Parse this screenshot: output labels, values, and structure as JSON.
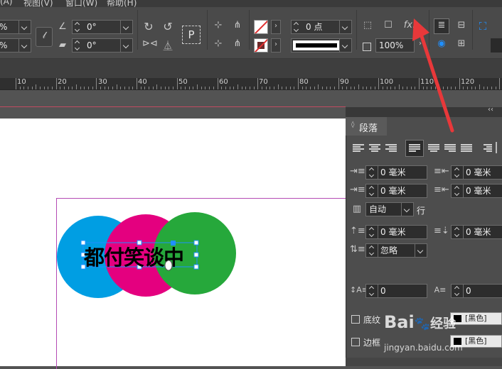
{
  "menu": {
    "items": [
      "(A)",
      "视图(V)",
      "窗口(W)",
      "帮助(H)"
    ]
  },
  "control_panel": {
    "scale_x": "%",
    "scale_y": "%",
    "rotate_angle": "0°",
    "shear_angle": "0°",
    "stroke_weight": "0 点",
    "opacity": "100%",
    "fx_label": "fx.",
    "p_label": "P"
  },
  "ruler": {
    "labels": [
      "10",
      "20",
      "30",
      "40",
      "50",
      "60",
      "70",
      "80",
      "90",
      "100",
      "110",
      "120"
    ]
  },
  "canvas": {
    "text_frame": "都付笑谈中",
    "circle_colors": [
      "#009ee3",
      "#e4007f",
      "#26a83b"
    ]
  },
  "paragraph_panel": {
    "title": "段落",
    "left_indent": "0 毫米",
    "right_indent": "0 毫米",
    "first_line_indent": "0 毫米",
    "last_line_indent": "0 毫米",
    "auto_leading": "自动",
    "line_label": "行",
    "space_before": "0 毫米",
    "space_after": "0 毫米",
    "grid_align": "忽略",
    "drop_cap_lines": "0",
    "drop_cap_chars": "0",
    "shading_label": "底纹",
    "border_label": "边框",
    "shading_color": "[黑色]",
    "border_color": "[黑色]"
  },
  "watermark": {
    "brand": "Bai",
    "paw": "du",
    "cn": "经验",
    "url": "jingyan.baidu.com"
  },
  "colors": {
    "accent_selection": "#1f8fff",
    "arrow": "#e8383a"
  }
}
